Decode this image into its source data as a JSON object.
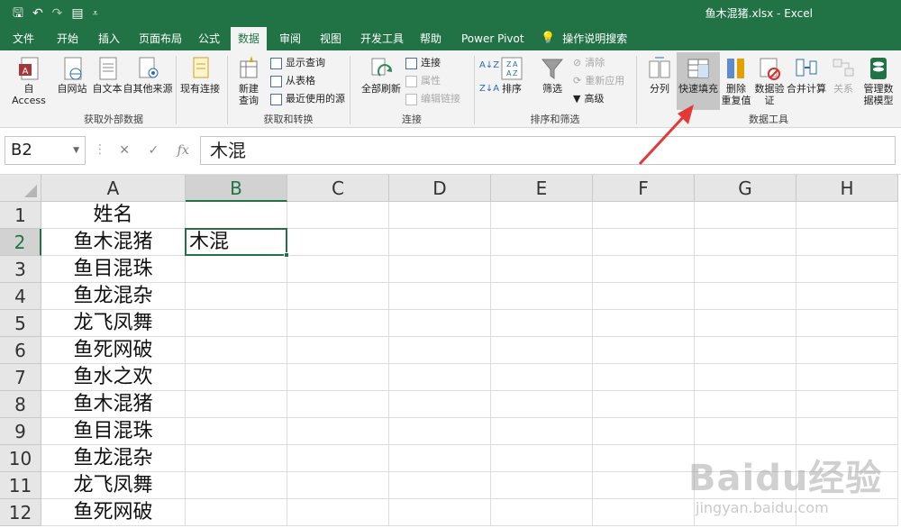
{
  "window": {
    "doc_title": "鱼木混猪.xlsx  -  Excel",
    "qat": {
      "save": "🖫",
      "undo": "↶",
      "redo": "↷",
      "form": "▤",
      "more": "⩡"
    }
  },
  "tabs": [
    {
      "label": "文件"
    },
    {
      "label": "开始"
    },
    {
      "label": "插入"
    },
    {
      "label": "页面布局"
    },
    {
      "label": "公式"
    },
    {
      "label": "数据",
      "active": true
    },
    {
      "label": "审阅"
    },
    {
      "label": "视图"
    },
    {
      "label": "开发工具"
    },
    {
      "label": "帮助"
    },
    {
      "label": "Power Pivot"
    }
  ],
  "tell_me": {
    "icon": "lightbulb-icon",
    "label": "操作说明搜索"
  },
  "ribbon": {
    "get_external": {
      "label": "获取外部数据",
      "buttons": [
        "自 Access",
        "自网站",
        "自文本",
        "自其他来源",
        "现有连接"
      ]
    },
    "get_transform": {
      "label": "获取和转换",
      "new_query": "新建\n查询",
      "show_queries": "显示查询",
      "from_table": "从表格",
      "recent_sources": "最近使用的源"
    },
    "connections": {
      "label": "连接",
      "refresh_all": "全部刷新",
      "connections": "连接",
      "properties": "属性",
      "edit_links": "编辑链接"
    },
    "sort_filter": {
      "label": "排序和筛选",
      "sort": "排序",
      "filter": "筛选",
      "clear": "清除",
      "reapply": "重新应用",
      "advanced": "高级"
    },
    "data_tools": {
      "label": "数据工具",
      "text_to_columns": "分列",
      "flash_fill": "快速填充",
      "remove_duplicates_1": "删除",
      "remove_duplicates_2": "重复值",
      "data_validation_1": "数据验",
      "data_validation_2": "证",
      "consolidate": "合并计算",
      "relationships": "关系",
      "manage_model_1": "管理数",
      "manage_model_2": "据模型"
    }
  },
  "formula_bar": {
    "name_box": "B2",
    "cancel": "✕",
    "enter": "✓",
    "fx": "fx",
    "value": "木混"
  },
  "columns": [
    "A",
    "B",
    "C",
    "D",
    "E",
    "F",
    "G",
    "H"
  ],
  "rows": [
    "1",
    "2",
    "3",
    "4",
    "5",
    "6",
    "7",
    "8",
    "9",
    "10",
    "11",
    "12"
  ],
  "cells": {
    "A": [
      "姓名",
      "鱼木混猪",
      "鱼目混珠",
      "鱼龙混杂",
      "龙飞凤舞",
      "鱼死网破",
      "鱼水之欢",
      "鱼木混猪",
      "鱼目混珠",
      "鱼龙混杂",
      "龙飞凤舞",
      "鱼死网破"
    ],
    "B": [
      "",
      "木混",
      "",
      "",
      "",
      "",
      "",
      "",
      "",
      "",
      "",
      ""
    ]
  },
  "active_cell": "B2",
  "watermark": {
    "main": "Baidu经验",
    "sub": "jingyan.baidu.com"
  },
  "colors": {
    "excel_green": "#217346",
    "arrow_red": "#e53935"
  }
}
